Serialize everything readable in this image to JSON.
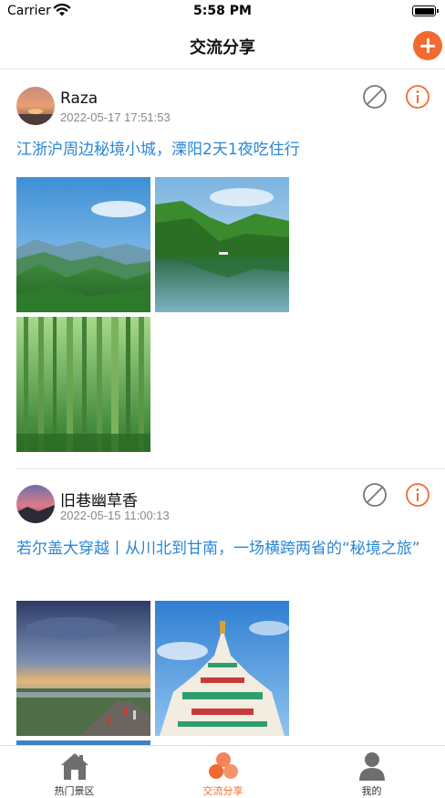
{
  "status_bar": {
    "carrier": "Carrier",
    "time": "5:58 PM"
  },
  "nav": {
    "title": "交流分享",
    "add_icon": "plus-circle-icon"
  },
  "colors": {
    "accent": "#f26a2f",
    "link": "#2a86d6",
    "muted": "#888888"
  },
  "posts": [
    {
      "user": "Raza",
      "time": "2022-05-17 17:51:53",
      "title": "江浙沪周边秘境小城，溧阳2天1夜吃住行",
      "actions": [
        "block-icon",
        "info-icon"
      ],
      "photos": [
        "mountain-valley",
        "lake-reflection",
        "bamboo-forest"
      ]
    },
    {
      "user": "旧巷幽草香",
      "time": "2022-05-15 11:00:13",
      "title": "若尔盖大穿越丨从川北到甘南，一场横跨两省的“秘境之旅”",
      "actions": [
        "block-icon",
        "info-icon"
      ],
      "photos": [
        "grassland-sunset",
        "tibetan-stupa",
        "third-photo"
      ]
    }
  ],
  "tabs": [
    {
      "label": "热门景区",
      "icon": "house-icon",
      "active": false
    },
    {
      "label": "交流分享",
      "icon": "share-circles-icon",
      "active": true
    },
    {
      "label": "我的",
      "icon": "person-icon",
      "active": false
    }
  ]
}
